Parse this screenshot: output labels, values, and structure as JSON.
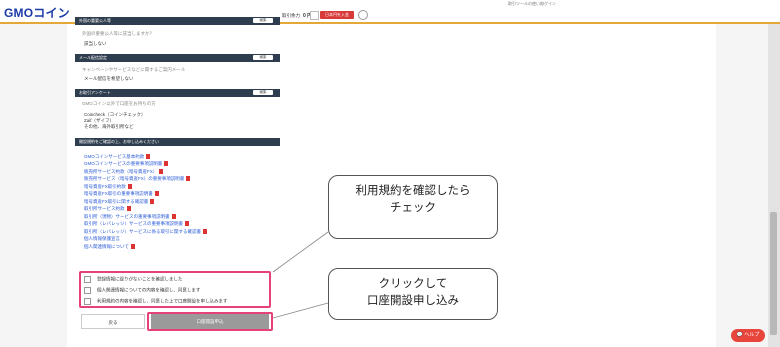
{
  "header": {
    "logo_main": "GMO",
    "logo_coin": "コイン",
    "top_links": [
      "取引ツールの使い方",
      "ログイン"
    ],
    "balance_label": "取引余力",
    "balance_value": "0 円",
    "deposit_label": "日本円を入金"
  },
  "sections": [
    {
      "title": "外国の重要公人等",
      "edit": "編集",
      "question": "外国の重要公人等に該当しますか？",
      "answer": "該当しない"
    },
    {
      "title": "メール配信設定",
      "edit": "編集",
      "question": "キャンペーンやサービスなどに関するご案内メール",
      "answer": "メール配信を希望しない"
    },
    {
      "title": "お取引アンケート",
      "edit": "編集",
      "question": "GMOコイン以外で口座をお持ちの方",
      "answers": [
        "Coincheck（コインチェック）",
        "Zaif（ザイフ）",
        "その他、海外取引所など"
      ]
    }
  ],
  "terms": {
    "title": "開設規約をご確認の上、お申し込みください",
    "links": [
      "GMOコインサービス基本約款",
      "GMOコインサービスの重要事項説明書",
      "販売所サービス約款（暗号資産FX）",
      "販売所サービス（暗号資産FX）の重要事項説明書",
      "暗号資産FX取引約款",
      "暗号資産FX取引の重要事項説明書",
      "暗号資産FX取引に関する確認書",
      "取引所サービス約款",
      "取引所（現物）サービスの重要事項説明書",
      "取引所（レバレッジ）サービスの重要事項説明書",
      "取引所（レバレッジ）サービスに係る取引に関する確認書",
      "個人情報保護宣言",
      "個人関連情報について"
    ]
  },
  "checkboxes": [
    "登録情報に誤りがないことを確認しました",
    "個人関連情報についての内容を確認し、同意します",
    "利用規約の内容を確認し、同意した上で口座開設を申し込みます"
  ],
  "buttons": {
    "back": "戻る",
    "submit": "口座開設申込"
  },
  "callouts": {
    "c1_line1": "利用規約を確認したら",
    "c1_line2": "チェック",
    "c2_line1": "クリックして",
    "c2_line2": "口座開設申し込み"
  },
  "help": "ヘルプ",
  "colors": {
    "accent": "#e6417a",
    "brand": "#1a3aa6",
    "link": "#2b5bd7",
    "deposit": "#d83a3a",
    "header_bar": "#2f3e4e"
  }
}
